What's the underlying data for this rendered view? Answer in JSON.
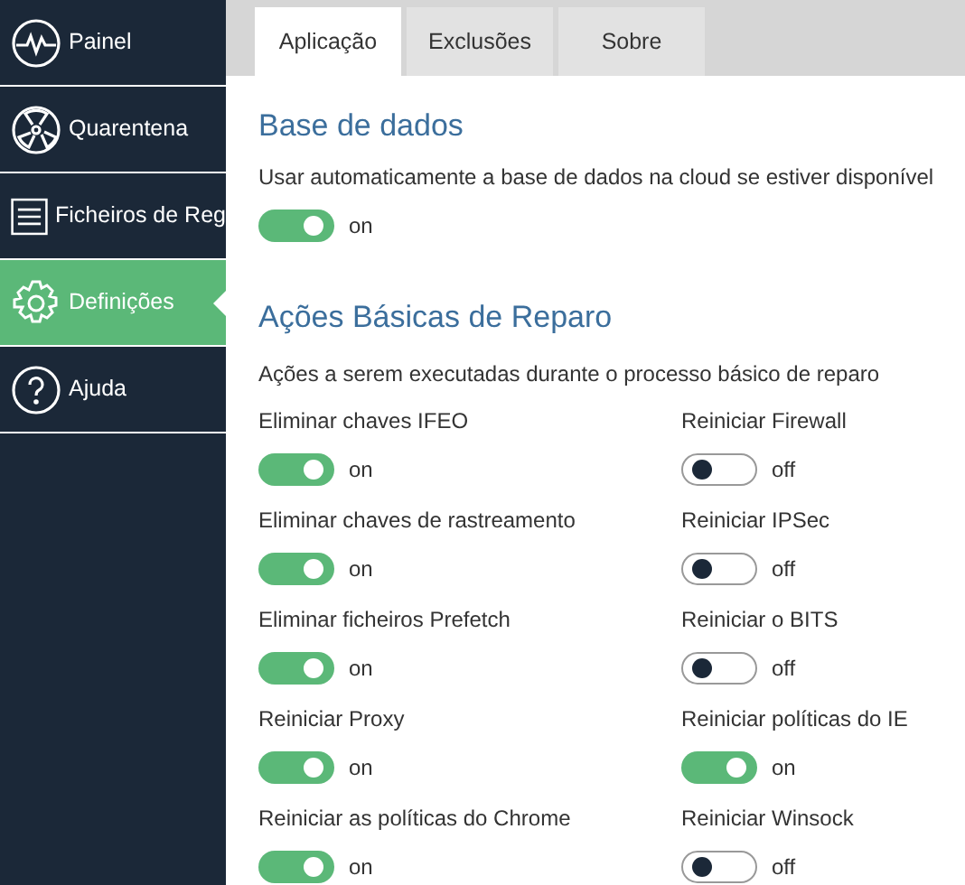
{
  "sidebar": {
    "items": [
      {
        "label": "Painel",
        "selected": false
      },
      {
        "label": "Quarentena",
        "selected": false
      },
      {
        "label": "Ficheiros de Reg",
        "selected": false
      },
      {
        "label": "Definições",
        "selected": true
      },
      {
        "label": "Ajuda",
        "selected": false
      }
    ]
  },
  "tabs": [
    {
      "label": "Aplicação",
      "selected": true
    },
    {
      "label": "Exclusões",
      "selected": false
    },
    {
      "label": "Sobre",
      "selected": false
    }
  ],
  "sections": [
    {
      "title": "Base de dados",
      "description": "Usar automaticamente a base de dados na cloud se estiver disponível",
      "options": [
        {
          "toggle": {
            "on": true,
            "state_text": "on"
          }
        }
      ]
    },
    {
      "title": "Ações Básicas de Reparo",
      "description": "Ações a serem executadas durante o processo básico de reparo",
      "options": [
        {
          "label": "Eliminar chaves IFEO",
          "toggle": {
            "on": true,
            "state_text": "on"
          }
        },
        {
          "label": "Reiniciar Firewall",
          "toggle": {
            "on": false,
            "state_text": "off"
          }
        },
        {
          "label": "Eliminar chaves de rastreamento",
          "toggle": {
            "on": true,
            "state_text": "on"
          }
        },
        {
          "label": "Reiniciar IPSec",
          "toggle": {
            "on": false,
            "state_text": "off"
          }
        },
        {
          "label": "Eliminar ficheiros Prefetch",
          "toggle": {
            "on": true,
            "state_text": "on"
          }
        },
        {
          "label": "Reiniciar o BITS",
          "toggle": {
            "on": false,
            "state_text": "off"
          }
        },
        {
          "label": "Reiniciar Proxy",
          "toggle": {
            "on": true,
            "state_text": "on"
          }
        },
        {
          "label": "Reiniciar políticas do IE",
          "toggle": {
            "on": true,
            "state_text": "on"
          }
        },
        {
          "label": "Reiniciar as políticas do Chrome",
          "toggle": {
            "on": true,
            "state_text": "on"
          }
        },
        {
          "label": "Reiniciar Winsock",
          "toggle": {
            "on": false,
            "state_text": "off"
          }
        }
      ]
    }
  ]
}
